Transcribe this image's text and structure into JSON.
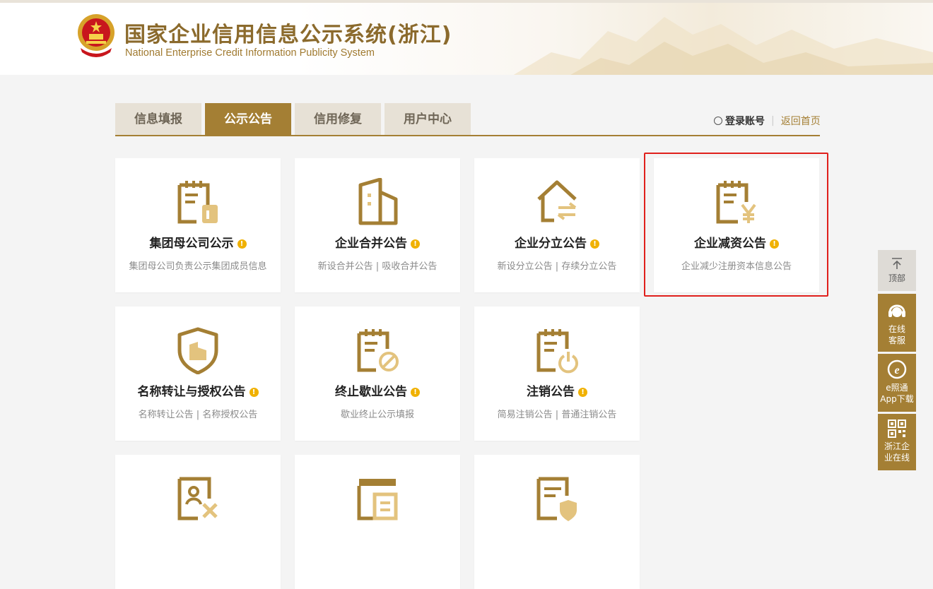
{
  "header": {
    "title_cn": "国家企业信用信息公示系统(浙江)",
    "title_en": "National Enterprise Credit Information Publicity System"
  },
  "tabs": [
    {
      "label": "信息填报",
      "active": false
    },
    {
      "label": "公示公告",
      "active": true
    },
    {
      "label": "信用修复",
      "active": false
    },
    {
      "label": "用户中心",
      "active": false
    }
  ],
  "account": {
    "login": "登录账号",
    "home": "返回首页"
  },
  "cards": [
    {
      "title": "集团母公司公示",
      "subtitle": "集团母公司负责公示集团成员信息",
      "icon": "clipboard-building-icon"
    },
    {
      "title": "企业合并公告",
      "subtitle": "新设合并公告 | 吸收合并公告",
      "icon": "building-icon"
    },
    {
      "title": "企业分立公告",
      "subtitle": "新设分立公告 | 存续分立公告",
      "icon": "house-exchange-icon"
    },
    {
      "title": "企业减资公告",
      "subtitle": "企业减少注册资本信息公告",
      "icon": "clipboard-yen-icon"
    },
    {
      "title": "名称转让与授权公告",
      "subtitle": "名称转让公告 | 名称授权公告",
      "icon": "shield-building-icon"
    },
    {
      "title": "终止歇业公告",
      "subtitle": "歇业终止公示填报",
      "icon": "clipboard-forbidden-icon"
    },
    {
      "title": "注销公告",
      "subtitle": "简易注销公告 | 普通注销公告",
      "icon": "clipboard-power-icon"
    },
    {
      "title": "",
      "subtitle": "",
      "icon": "id-card-x-icon"
    },
    {
      "title": "",
      "subtitle": "",
      "icon": "window-document-icon"
    },
    {
      "title": "",
      "subtitle": "",
      "icon": "document-shield-icon"
    }
  ],
  "sidebar": {
    "top": "顶部",
    "service_line1": "在线",
    "service_line2": "客服",
    "app_line1": "e照通",
    "app_line2": "App下载",
    "online_line1": "浙江企",
    "online_line2": "业在线"
  },
  "colors": {
    "gold": "#a47f34",
    "light_gold": "#e3c37e",
    "highlight": "#e0201c",
    "info_badge": "#f0b100"
  }
}
